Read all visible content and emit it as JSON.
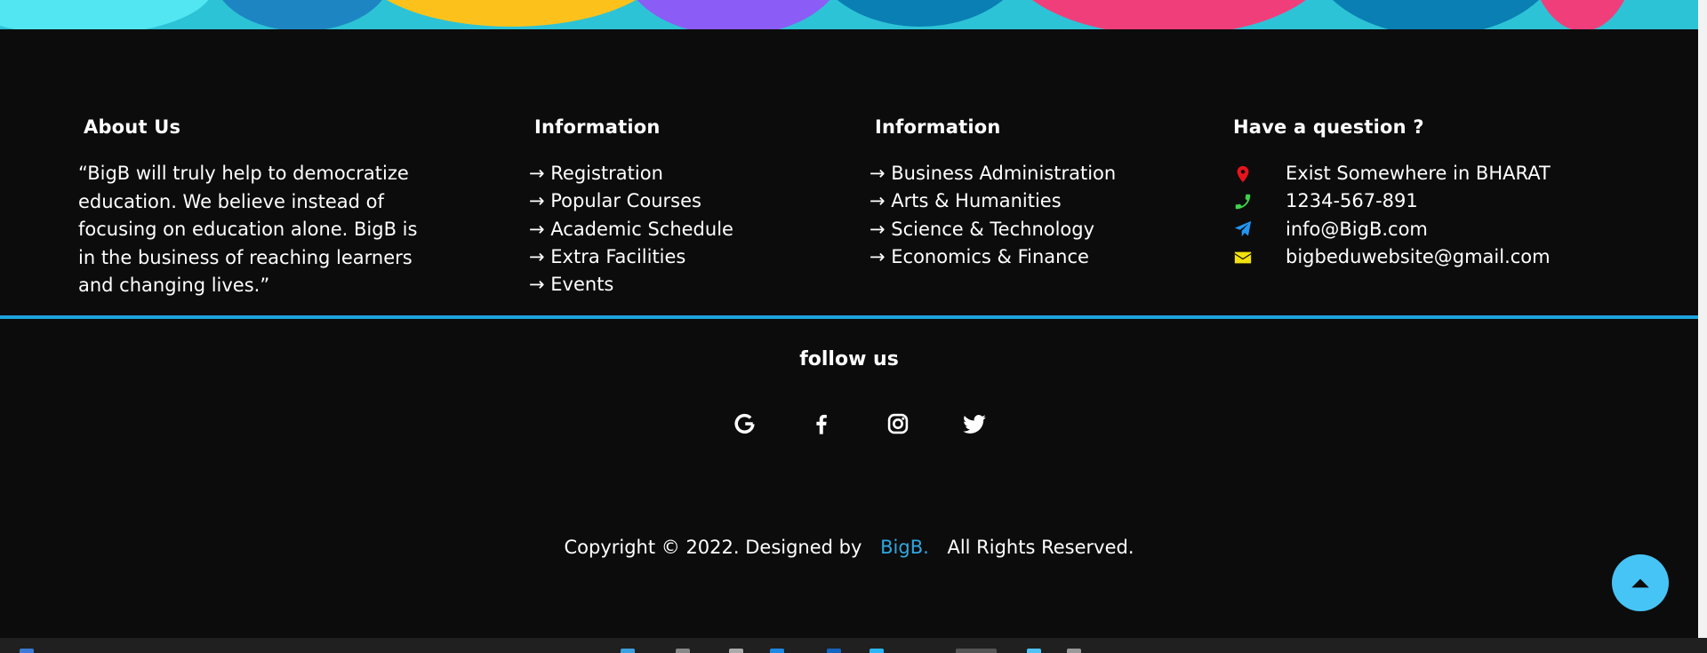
{
  "about": {
    "title": "About Us",
    "text": "“BigB will truly help to democratize education. We believe instead of focusing on education alone. BigB is in the business of reaching learners and changing lives.”"
  },
  "info1": {
    "title": "Information",
    "links": [
      "→ Registration",
      "→ Popular Courses",
      "→ Academic Schedule",
      "→ Extra Facilities",
      "→ Events"
    ]
  },
  "info2": {
    "title": "Information",
    "links": [
      "→ Business Administration",
      "→ Arts & Humanities",
      "→ Science & Technology",
      "→ Economics & Finance"
    ]
  },
  "contact": {
    "title": "Have a question ?",
    "items": [
      {
        "icon": "map-marker-icon",
        "color": "#e8131b",
        "text": "Exist Somewhere in BHARAT"
      },
      {
        "icon": "phone-icon",
        "color": "#3fd14a",
        "text": "1234-567-891"
      },
      {
        "icon": "paper-plane-icon",
        "color": "#2196f3",
        "text": "info@BigB.com"
      },
      {
        "icon": "envelope-icon",
        "color": "#f2e10f",
        "text": "bigbeduwebsite@gmail.com"
      }
    ]
  },
  "follow": {
    "title": "follow us",
    "icons": [
      "google-icon",
      "facebook-icon",
      "instagram-icon",
      "twitter-icon"
    ]
  },
  "copyright": {
    "prefix": "Copyright © 2022. Designed by",
    "brand": "BigB.",
    "suffix": "All Rights Reserved."
  },
  "colors": {
    "background": "#0c0c0c",
    "accent": "#1ea3dc",
    "to_top_button": "#46c4f5"
  }
}
